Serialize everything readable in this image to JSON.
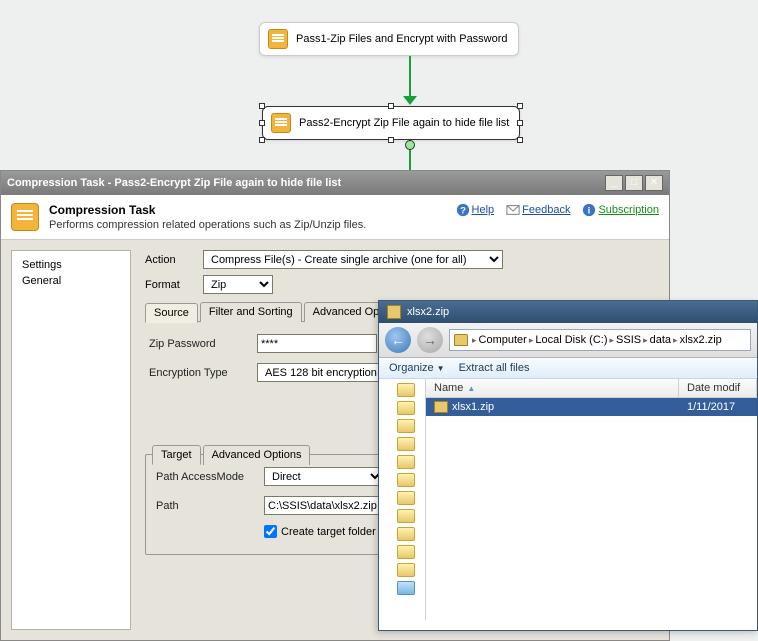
{
  "diagram": {
    "node1": "Pass1-Zip Files and Encrypt with Password",
    "node2": "Pass2-Encrypt Zip File again to hide file list"
  },
  "dialog": {
    "title": "Compression Task - Pass2-Encrypt Zip File again to hide file list",
    "header_title": "Compression Task",
    "header_desc": "Performs compression related operations such as Zip/Unzip files.",
    "links": {
      "help": "Help",
      "feedback": "Feedback",
      "subscription": "Subscription"
    },
    "sidebar": {
      "items": [
        "Settings",
        "General"
      ]
    },
    "form": {
      "action_label": "Action",
      "action_value": "Compress File(s) - Create single archive (one for all)",
      "format_label": "Format",
      "format_value": "Zip",
      "tabs": [
        "Source",
        "Filter and Sorting",
        "Advanced Option"
      ],
      "zip_password_label": "Zip Password",
      "zip_password_value": "****",
      "encryption_label": "Encryption Type",
      "encryption_value": "AES 128 bit encryption",
      "target_tabs": [
        "Target",
        "Advanced Options"
      ],
      "path_mode_label": "Path AccessMode",
      "path_mode_value": "Direct",
      "path_label": "Path",
      "path_value": "C:\\SSIS\\data\\xlsx2.zip",
      "create_folder_label": "Create target folder"
    }
  },
  "explorer": {
    "title": "xlsx2.zip",
    "breadcrumb": [
      "Computer",
      "Local Disk (C:)",
      "SSIS",
      "data",
      "xlsx2.zip"
    ],
    "toolbar": {
      "organize": "Organize",
      "extract": "Extract all files"
    },
    "columns": {
      "name": "Name",
      "date": "Date modif"
    },
    "row": {
      "name": "xlsx1.zip",
      "date": "1/11/2017"
    }
  }
}
